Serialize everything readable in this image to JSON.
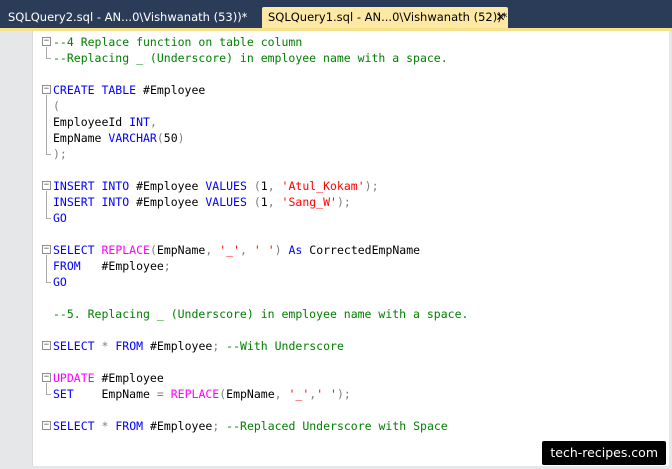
{
  "tabs": [
    {
      "label": "SQLQuery2.sql - AN...0\\Vishwanath (53))*",
      "active": false
    },
    {
      "label": "SQLQuery1.sql - AN...0\\Vishwanath (52))*",
      "active": true
    }
  ],
  "tab_close_glyph": "✕",
  "colors": {
    "tabbar": "#2b3c59",
    "active_tab": "#fde9a4",
    "keyword": "#0000ff",
    "function": "#ff00ff",
    "string": "#ff0000",
    "comment": "#008000",
    "operator": "#808080"
  },
  "editor": {
    "lines": [
      {
        "segments": [
          {
            "t": "--4 Replace function on table column",
            "c": "comment"
          }
        ]
      },
      {
        "segments": [
          {
            "t": "--Replacing _ (Underscore) in employee name with a space.",
            "c": "comment"
          }
        ]
      },
      {
        "segments": []
      },
      {
        "segments": [
          {
            "t": "CREATE TABLE",
            "c": "keyword"
          },
          {
            "t": " #Employee",
            "c": "plain"
          }
        ]
      },
      {
        "segments": [
          {
            "t": "(",
            "c": "op"
          }
        ]
      },
      {
        "segments": [
          {
            "t": "EmployeeId ",
            "c": "plain"
          },
          {
            "t": "INT",
            "c": "keyword"
          },
          {
            "t": ",",
            "c": "op"
          }
        ]
      },
      {
        "segments": [
          {
            "t": "EmpName ",
            "c": "plain"
          },
          {
            "t": "VARCHAR",
            "c": "keyword"
          },
          {
            "t": "(",
            "c": "op"
          },
          {
            "t": "50",
            "c": "plain"
          },
          {
            "t": ")",
            "c": "op"
          }
        ]
      },
      {
        "segments": [
          {
            "t": ");",
            "c": "op"
          }
        ]
      },
      {
        "segments": []
      },
      {
        "segments": [
          {
            "t": "INSERT INTO",
            "c": "keyword"
          },
          {
            "t": " #Employee ",
            "c": "plain"
          },
          {
            "t": "VALUES",
            "c": "keyword"
          },
          {
            "t": " (",
            "c": "op"
          },
          {
            "t": "1",
            "c": "plain"
          },
          {
            "t": ", ",
            "c": "op"
          },
          {
            "t": "'Atul_Kokam'",
            "c": "string"
          },
          {
            "t": ");",
            "c": "op"
          }
        ]
      },
      {
        "segments": [
          {
            "t": "INSERT INTO",
            "c": "keyword"
          },
          {
            "t": " #Employee ",
            "c": "plain"
          },
          {
            "t": "VALUES",
            "c": "keyword"
          },
          {
            "t": " (",
            "c": "op"
          },
          {
            "t": "1",
            "c": "plain"
          },
          {
            "t": ", ",
            "c": "op"
          },
          {
            "t": "'Sang_W'",
            "c": "string"
          },
          {
            "t": ");",
            "c": "op"
          }
        ]
      },
      {
        "segments": [
          {
            "t": "GO",
            "c": "keyword"
          }
        ]
      },
      {
        "segments": []
      },
      {
        "segments": [
          {
            "t": "SELECT",
            "c": "keyword"
          },
          {
            "t": " ",
            "c": "plain"
          },
          {
            "t": "REPLACE",
            "c": "function"
          },
          {
            "t": "(",
            "c": "op"
          },
          {
            "t": "EmpName",
            "c": "plain"
          },
          {
            "t": ", ",
            "c": "op"
          },
          {
            "t": "'_'",
            "c": "string"
          },
          {
            "t": ", ",
            "c": "op"
          },
          {
            "t": "' '",
            "c": "string"
          },
          {
            "t": ") ",
            "c": "op"
          },
          {
            "t": "As",
            "c": "keyword"
          },
          {
            "t": " CorrectedEmpName",
            "c": "plain"
          }
        ]
      },
      {
        "segments": [
          {
            "t": "FROM",
            "c": "keyword"
          },
          {
            "t": "   #Employee",
            "c": "plain"
          },
          {
            "t": ";",
            "c": "op"
          }
        ]
      },
      {
        "segments": [
          {
            "t": "GO",
            "c": "keyword"
          }
        ]
      },
      {
        "segments": []
      },
      {
        "segments": [
          {
            "t": "--5. Replacing _ (Underscore) in employee name with a space.",
            "c": "comment"
          }
        ]
      },
      {
        "segments": []
      },
      {
        "segments": [
          {
            "t": "SELECT",
            "c": "keyword"
          },
          {
            "t": " ",
            "c": "plain"
          },
          {
            "t": "*",
            "c": "op"
          },
          {
            "t": " ",
            "c": "plain"
          },
          {
            "t": "FROM",
            "c": "keyword"
          },
          {
            "t": " #Employee",
            "c": "plain"
          },
          {
            "t": "; ",
            "c": "op"
          },
          {
            "t": "--With Underscore",
            "c": "comment"
          }
        ]
      },
      {
        "segments": []
      },
      {
        "segments": [
          {
            "t": "UPDATE",
            "c": "function"
          },
          {
            "t": " #Employee",
            "c": "plain"
          }
        ]
      },
      {
        "segments": [
          {
            "t": "SET",
            "c": "keyword"
          },
          {
            "t": "    EmpName ",
            "c": "plain"
          },
          {
            "t": "=",
            "c": "op"
          },
          {
            "t": " ",
            "c": "plain"
          },
          {
            "t": "REPLACE",
            "c": "function"
          },
          {
            "t": "(",
            "c": "op"
          },
          {
            "t": "EmpName",
            "c": "plain"
          },
          {
            "t": ", ",
            "c": "op"
          },
          {
            "t": "'_'",
            "c": "string"
          },
          {
            "t": ",",
            "c": "op"
          },
          {
            "t": "' '",
            "c": "string"
          },
          {
            "t": ");",
            "c": "op"
          }
        ]
      },
      {
        "segments": []
      },
      {
        "segments": [
          {
            "t": "SELECT",
            "c": "keyword"
          },
          {
            "t": " ",
            "c": "plain"
          },
          {
            "t": "*",
            "c": "op"
          },
          {
            "t": " ",
            "c": "plain"
          },
          {
            "t": "FROM",
            "c": "keyword"
          },
          {
            "t": " #Employee",
            "c": "plain"
          },
          {
            "t": "; ",
            "c": "op"
          },
          {
            "t": "--Replaced Underscore with Space",
            "c": "comment"
          }
        ]
      }
    ]
  },
  "watermark": "tech-recipes.com"
}
